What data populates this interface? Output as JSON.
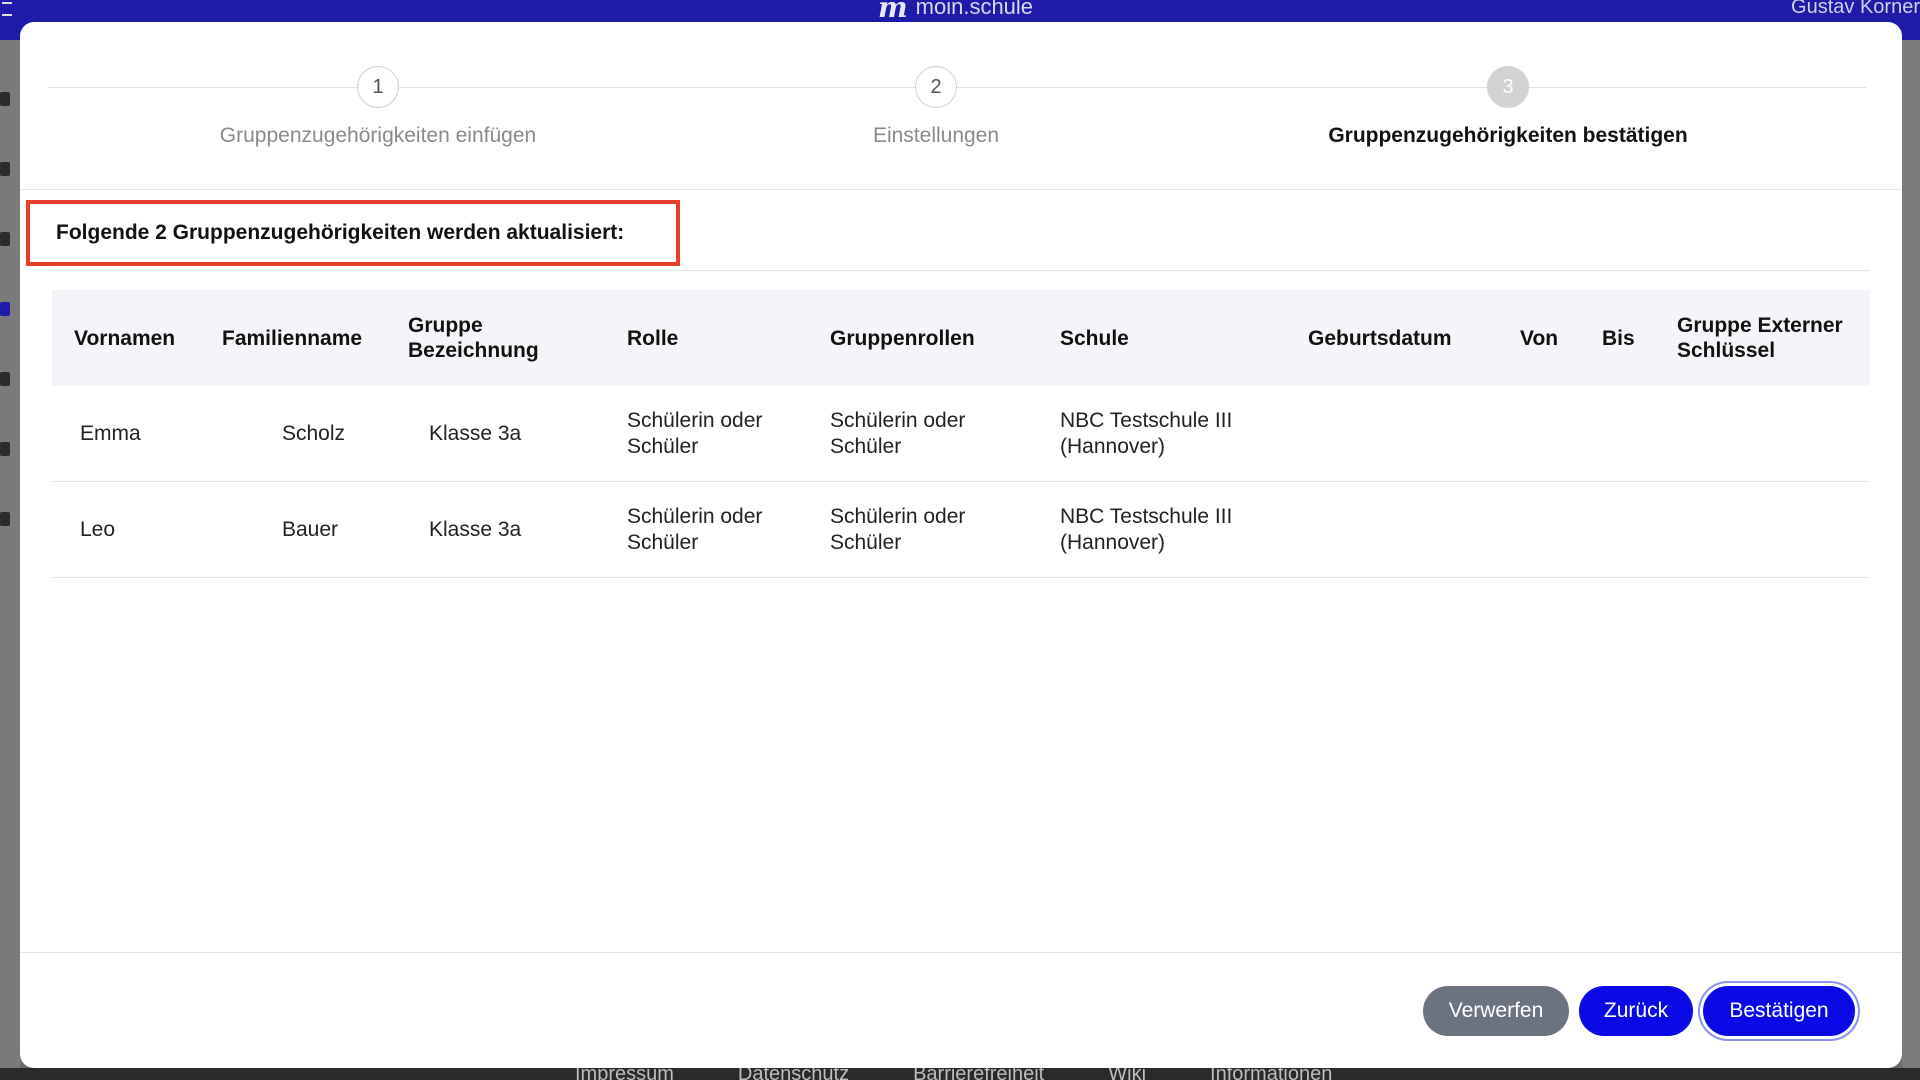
{
  "app": {
    "logo_text": "moin.schule",
    "user_name": "Gustav Korner"
  },
  "stepper": {
    "steps": [
      {
        "number": "1",
        "label": "Gruppenzugehörigkeiten einfügen"
      },
      {
        "number": "2",
        "label": "Einstellungen"
      },
      {
        "number": "3",
        "label": "Gruppenzugehörigkeiten bestätigen"
      }
    ],
    "active_step": 3
  },
  "heading": "Folgende 2 Gruppenzugehörigkeiten werden aktualisiert:",
  "table": {
    "columns": [
      "Vornamen",
      "Familienname",
      "Gruppe Bezeichnung",
      "Rolle",
      "Gruppenrollen",
      "Schule",
      "Geburtsdatum",
      "Von",
      "Bis",
      "Gruppe Externer Schlüssel"
    ],
    "rows": [
      {
        "vorname": "Emma",
        "familienname": "Scholz",
        "gruppe": "Klasse 3a",
        "rolle": "Schülerin oder Schüler",
        "gruppenrollen": "Schülerin oder Schüler",
        "schule": "NBC Testschule III (Hannover)"
      },
      {
        "vorname": "Leo",
        "familienname": "Bauer",
        "gruppe": "Klasse 3a",
        "rolle": "Schülerin oder Schüler",
        "gruppenrollen": "Schülerin oder Schüler",
        "schule": "NBC Testschule III (Hannover)"
      }
    ]
  },
  "buttons": {
    "discard": "Verwerfen",
    "back": "Zurück",
    "confirm": "Bestätigen"
  },
  "footer_links": [
    "Impressum",
    "Datenschutz",
    "Barrierefreiheit",
    "Wiki",
    "Informationen"
  ],
  "colors": {
    "primary": "#0a0ae6",
    "topbar": "#1d1ba8",
    "highlight_border": "#e5402a",
    "secondary_button": "#6b7280"
  }
}
